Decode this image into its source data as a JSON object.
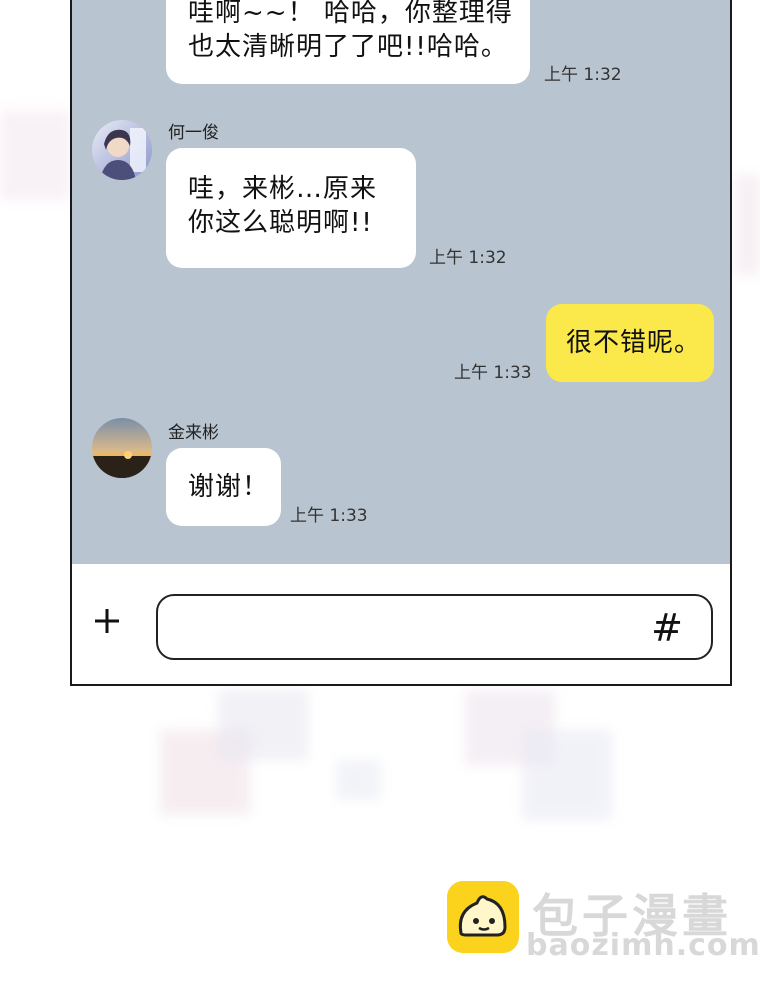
{
  "messages": [
    {
      "sender": "",
      "text": "哇啊~~！ 哈哈，你整理得\n也太清晰明了了吧!!哈哈。",
      "time": "上午 1:32"
    },
    {
      "sender": "何一俊",
      "text": "哇，来彬…原来\n你这么聪明啊!!",
      "time": "上午 1:32"
    },
    {
      "sender": "",
      "text": "很不错呢。",
      "time": "上午 1:33"
    },
    {
      "sender": "金来彬",
      "text": "谢谢！",
      "time": "上午 1:33"
    }
  ],
  "input": {
    "attach_icon": "plus-icon",
    "hash_icon": "hashtag-icon",
    "hash_glyph": "#"
  },
  "watermark": {
    "title": "包子漫畫",
    "url": "baozimh.com"
  },
  "colors": {
    "chat_bg": "#b8c4cf",
    "my_bubble": "#fbe84a",
    "other_bubble": "#ffffff",
    "logo": "#fbd21c"
  }
}
